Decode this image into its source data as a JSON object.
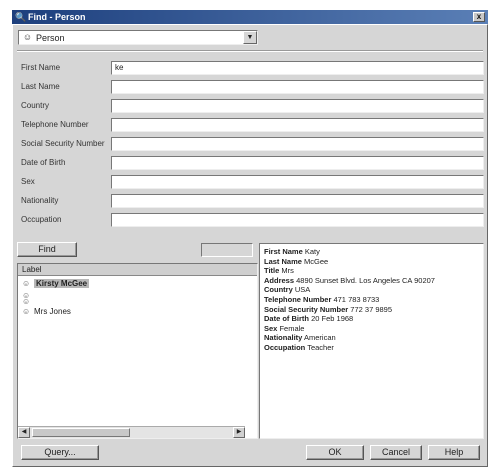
{
  "window": {
    "title": "Find - Person",
    "close_glyph": "x",
    "title_icon": "magnifier-icon"
  },
  "type_selector": {
    "icon": "person-icon",
    "value": "Person",
    "arrow_glyph": "▼"
  },
  "form_fields": [
    {
      "label": "First Name",
      "value": "ke"
    },
    {
      "label": "Last Name",
      "value": ""
    },
    {
      "label": "Country",
      "value": ""
    },
    {
      "label": "Telephone Number",
      "value": ""
    },
    {
      "label": "Social Security Number",
      "value": ""
    },
    {
      "label": "Date of Birth",
      "value": ""
    },
    {
      "label": "Sex",
      "value": ""
    },
    {
      "label": "Nationality",
      "value": ""
    },
    {
      "label": "Occupation",
      "value": ""
    }
  ],
  "find_button": "Find",
  "results_list": {
    "header": "Label",
    "items": [
      {
        "label": "Kirsty McGee",
        "selected": true
      },
      {
        "label": "",
        "selected": false
      },
      {
        "label": "",
        "selected": false
      },
      {
        "label": "Mrs Jones",
        "selected": false
      }
    ]
  },
  "details": [
    {
      "key": "First Name",
      "value": "Katy"
    },
    {
      "key": "Last Name",
      "value": "McGee"
    },
    {
      "key": "Title",
      "value": "Mrs"
    },
    {
      "key": "Address",
      "value": "4890 Sunset Blvd. Los Angeles CA 90207"
    },
    {
      "key": "Country",
      "value": "USA"
    },
    {
      "key": "Telephone Number",
      "value": "471 783 8733"
    },
    {
      "key": "Social Security Number",
      "value": "772 37 9895"
    },
    {
      "key": "Date of Birth",
      "value": "20 Feb 1968"
    },
    {
      "key": "Sex",
      "value": "Female"
    },
    {
      "key": "Nationality",
      "value": "American"
    },
    {
      "key": "Occupation",
      "value": "Teacher"
    }
  ],
  "buttons": {
    "query": "Query...",
    "ok": "OK",
    "cancel": "Cancel",
    "help": "Help"
  },
  "scrollbar": {
    "left_arrow": "◀",
    "right_arrow": "▶"
  }
}
